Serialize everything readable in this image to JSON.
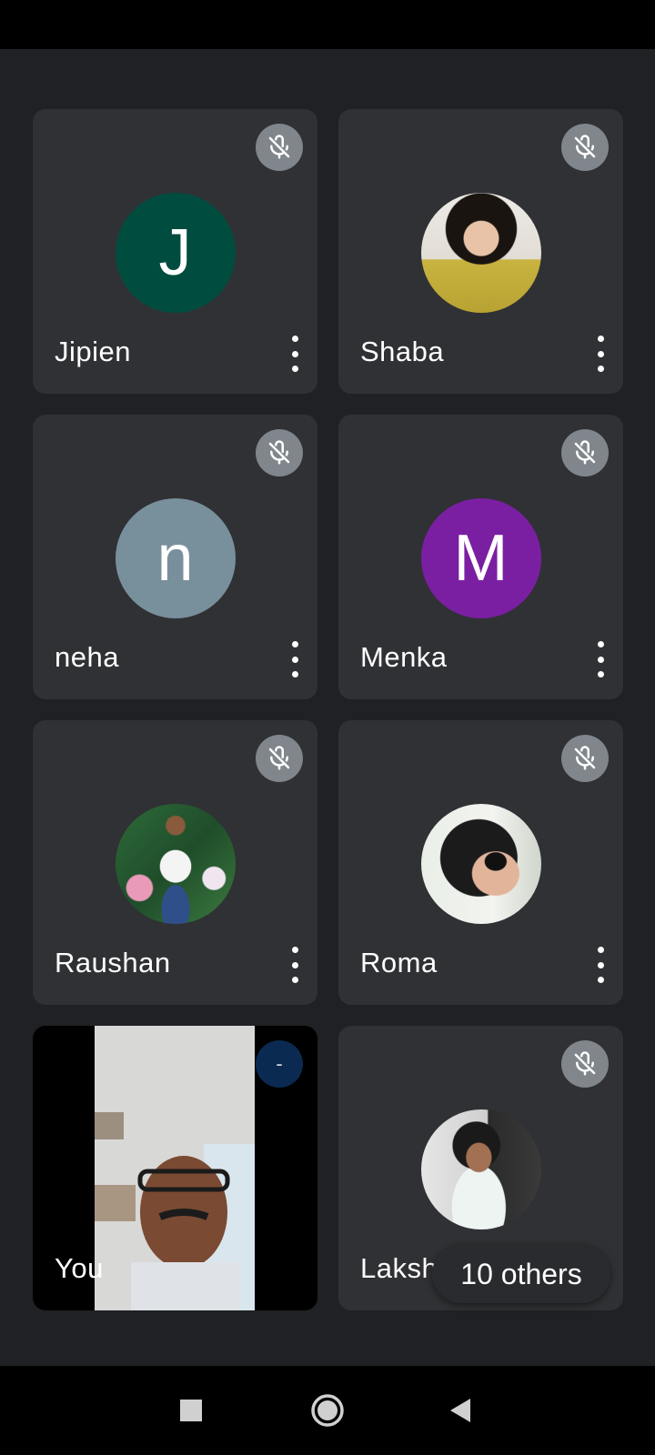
{
  "participants": [
    {
      "name": "Jipien",
      "avatar_letter": "J",
      "avatar_color": "#004d40",
      "type": "letter"
    },
    {
      "name": "Shaba",
      "type": "photo"
    },
    {
      "name": "neha",
      "avatar_letter": "n",
      "avatar_color": "#78909c",
      "type": "letter"
    },
    {
      "name": "Menka",
      "avatar_letter": "M",
      "avatar_color": "#7b1fa2",
      "type": "letter"
    },
    {
      "name": "Raushan",
      "type": "photo"
    },
    {
      "name": "Roma",
      "type": "photo"
    },
    {
      "name": "You",
      "type": "video",
      "badge": "-"
    },
    {
      "name": "Lakshmi",
      "type": "photo"
    }
  ],
  "others": {
    "label": "10 others"
  },
  "icons": {
    "mute": "mic-off-icon",
    "more": "more-vert-icon",
    "nav": [
      "stop-square-icon",
      "home-circle-icon",
      "back-triangle-icon"
    ]
  },
  "colors": {
    "background": "#202124",
    "tile": "#303134",
    "mute_bg": "#80868b"
  }
}
